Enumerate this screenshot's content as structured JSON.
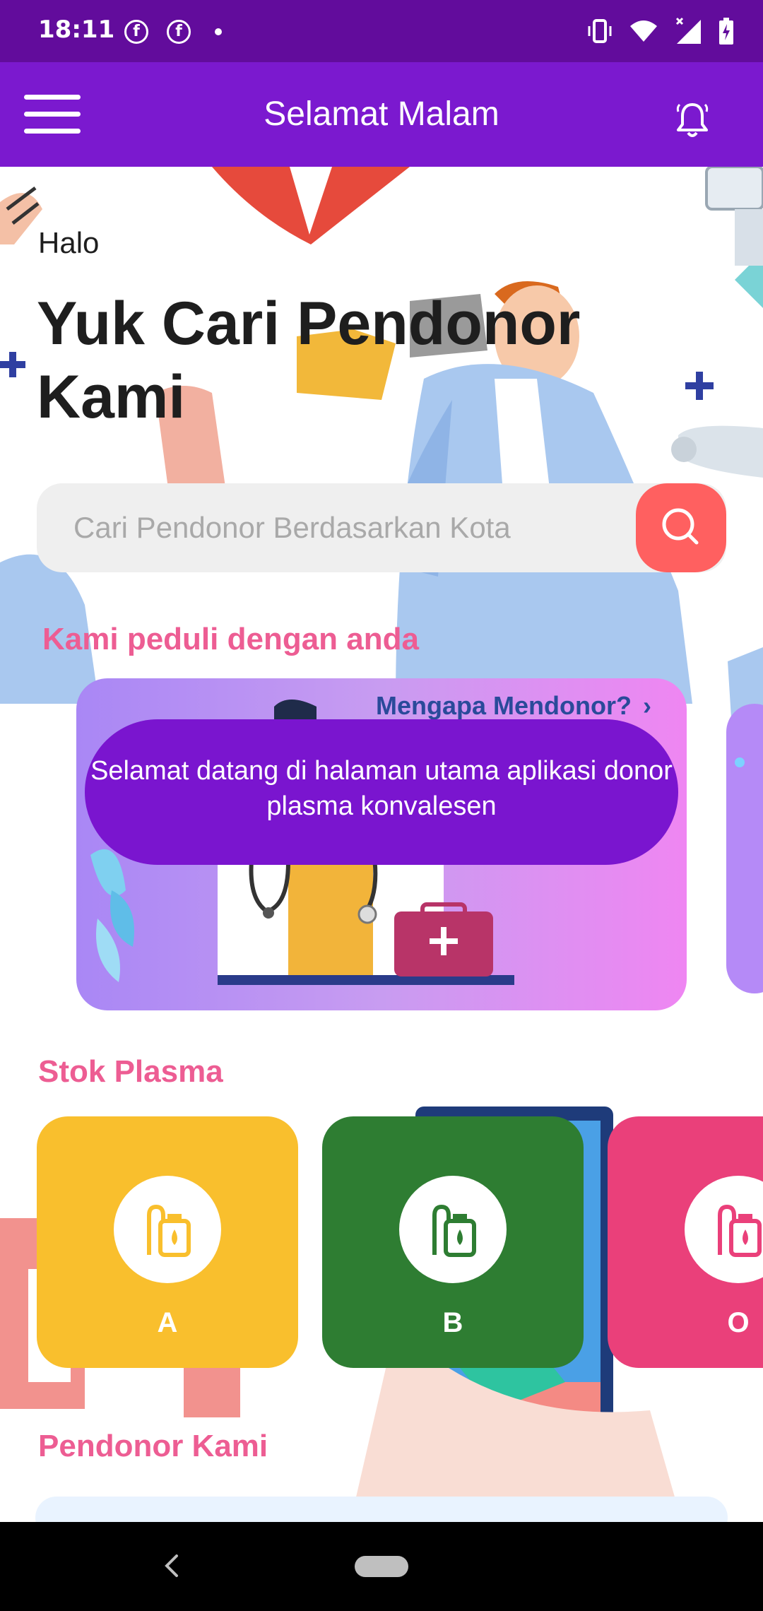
{
  "status_bar": {
    "time": "18:11",
    "notification_icons": [
      "facebook-icon",
      "facebook-icon",
      "dot-icon"
    ],
    "system_icons": [
      "vibrate-icon",
      "wifi-icon",
      "signal-icon",
      "battery-charging-icon"
    ]
  },
  "app_bar": {
    "title": "Selamat Malam",
    "menu_icon": "hamburger-menu-icon",
    "notification_icon": "bell-icon"
  },
  "hero": {
    "greeting": "Halo",
    "headline": "Yuk Cari Pendonor Kami"
  },
  "search": {
    "placeholder": "Cari Pendonor Berdasarkan Kota",
    "button_icon": "search-icon"
  },
  "care_section": {
    "title": "Kami peduli dengan anda",
    "banner_link": "Mengapa Mendonor?",
    "tooltip": "Selamat datang di halaman utama aplikasi donor plasma konvalesen"
  },
  "stock_section": {
    "title": "Stok Plasma",
    "cards": [
      {
        "label": "A",
        "color": "#f9bf2d"
      },
      {
        "label": "B",
        "color": "#2e7d32"
      },
      {
        "label": "O",
        "color": "#ea407a"
      }
    ]
  },
  "donor_section": {
    "title": "Pendonor Kami"
  },
  "colors": {
    "status_bar": "#620c9c",
    "app_bar": "#7b19cf",
    "accent_pink": "#ed5d93",
    "search_button": "#ff6060",
    "tooltip": "#7a15cf"
  }
}
